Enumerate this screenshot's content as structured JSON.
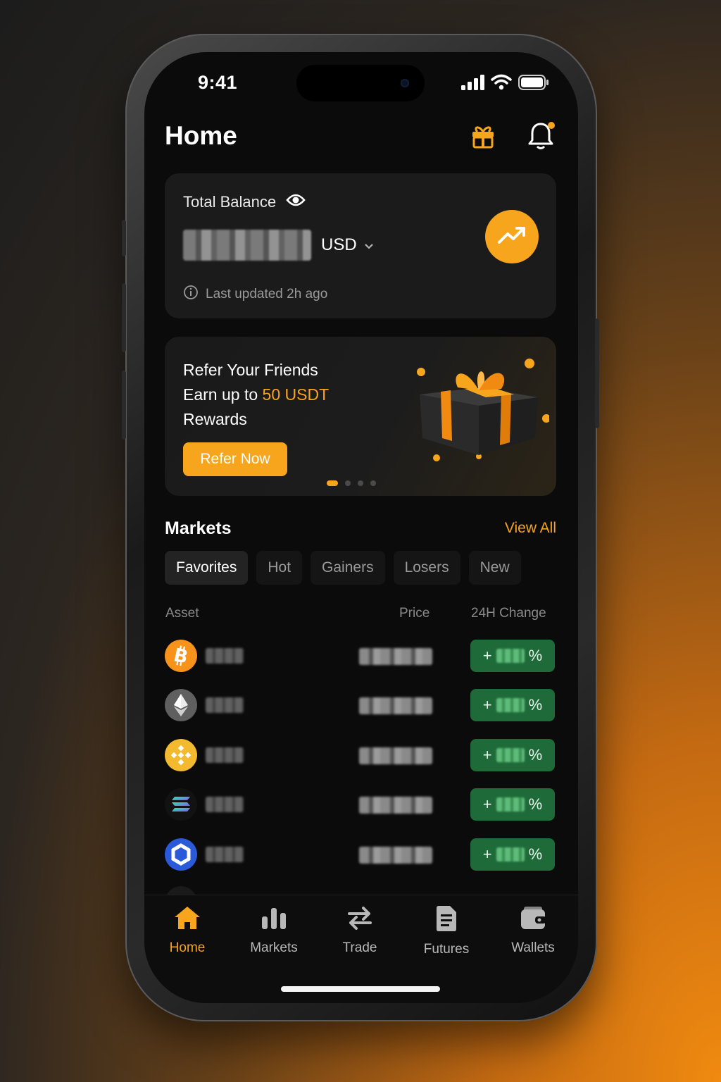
{
  "status_bar": {
    "time": "9:41"
  },
  "header": {
    "title": "Home"
  },
  "balance_card": {
    "label": "Total Balance",
    "currency": "USD",
    "updated_text": "Last updated 2h ago"
  },
  "promo": {
    "line1": "Refer Your Friends",
    "line2_prefix": "Earn up to ",
    "line2_highlight": "50 USDT",
    "line3": "Rewards",
    "button": "Refer Now",
    "slide_count": 4,
    "active_slide": 1
  },
  "markets": {
    "title": "Markets",
    "view_all": "View All",
    "tabs": [
      "Favorites",
      "Hot",
      "Gainers",
      "Losers",
      "New"
    ],
    "active_tab": "Favorites",
    "columns": {
      "asset": "Asset",
      "price": "Price",
      "change": "24H Change"
    },
    "rows": [
      {
        "icon": "bitcoin-icon",
        "change_prefix": "+",
        "change_suffix": "%"
      },
      {
        "icon": "ethereum-icon",
        "change_prefix": "+",
        "change_suffix": "%"
      },
      {
        "icon": "bnb-icon",
        "change_prefix": "+",
        "change_suffix": "%"
      },
      {
        "icon": "solana-icon",
        "change_prefix": "+",
        "change_suffix": "%"
      },
      {
        "icon": "chainlink-icon",
        "change_prefix": "+",
        "change_suffix": "%"
      }
    ]
  },
  "nav": {
    "items": [
      {
        "label": "Home",
        "icon": "home-icon"
      },
      {
        "label": "Markets",
        "icon": "bar-chart-icon"
      },
      {
        "label": "Trade",
        "icon": "swap-icon"
      },
      {
        "label": "Futures",
        "icon": "document-icon"
      },
      {
        "label": "Wallets",
        "icon": "wallet-icon"
      }
    ],
    "active": "Home"
  },
  "colors": {
    "accent": "#f7a51c",
    "positive": "#1e6b39",
    "card": "#1b1b1b",
    "screen": "#0b0b0b"
  }
}
